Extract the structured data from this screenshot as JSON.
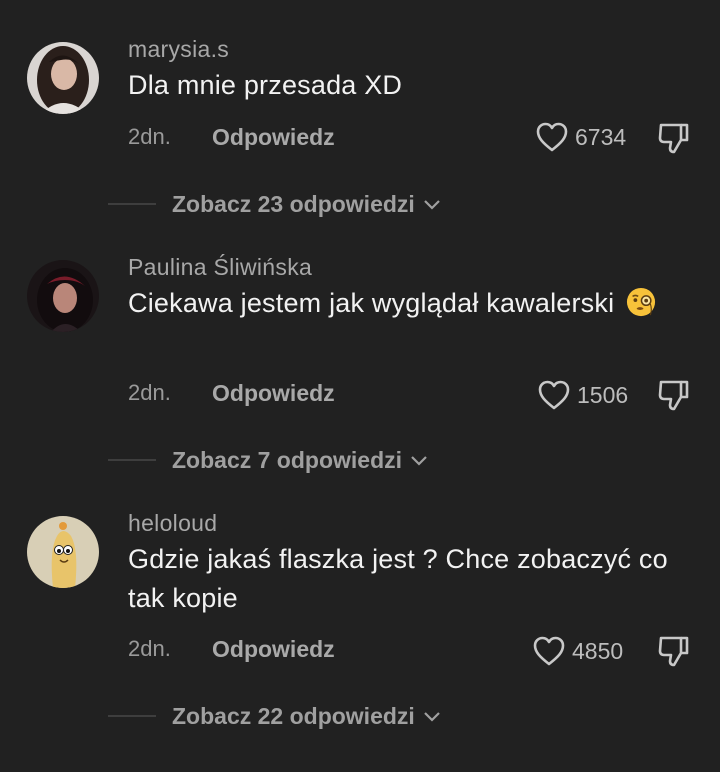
{
  "comments": [
    {
      "username": "marysia.s",
      "text": "Dla mnie przesada XD",
      "emoji": "",
      "time": "2dn.",
      "reply_label": "Odpowiedz",
      "likes": "6734",
      "view_replies": "Zobacz 23 odpowiedzi"
    },
    {
      "username": "Paulina Śliwińska",
      "text": "Ciekawa jestem jak wyglądał kawalerski",
      "emoji": "face-with-monocle",
      "time": "2dn.",
      "reply_label": "Odpowiedz",
      "likes": "1506",
      "view_replies": "Zobacz 7 odpowiedzi"
    },
    {
      "username": "heloloud",
      "text": "Gdzie jakaś flaszka jest ? Chce zobaczyć co tak kopie",
      "emoji": "",
      "time": "2dn.",
      "reply_label": "Odpowiedz",
      "likes": "4850",
      "view_replies": "Zobacz 22 odpowiedzi"
    }
  ],
  "icons": {
    "like": "heart-outline-icon",
    "dislike": "thumbs-down-icon",
    "expand": "chevron-down-icon"
  },
  "colors": {
    "background": "#212121",
    "username": "#a8a8a8",
    "text": "#f2f2f2",
    "secondary": "#9a9a9a"
  }
}
